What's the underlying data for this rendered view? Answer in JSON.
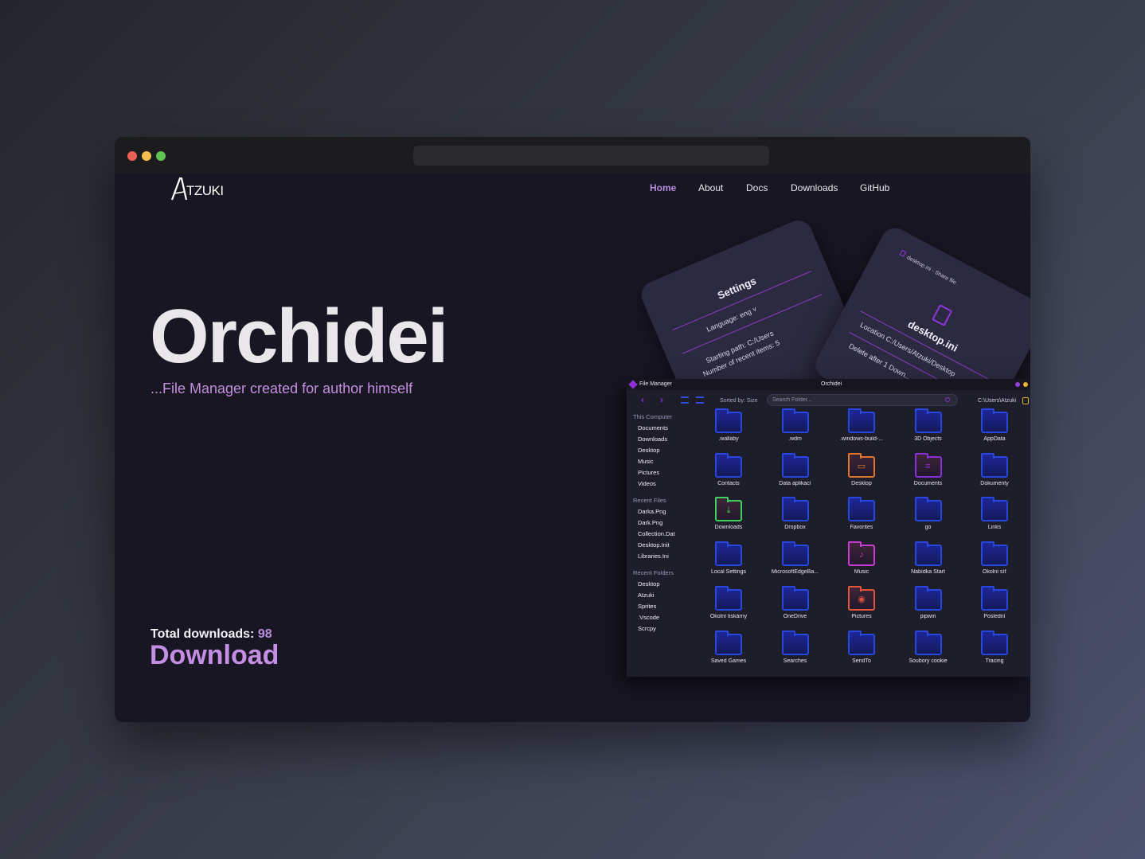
{
  "brand": {
    "logo_text": "TZUKI"
  },
  "nav": {
    "items": [
      {
        "label": "Home",
        "active": true
      },
      {
        "label": "About",
        "active": false
      },
      {
        "label": "Docs",
        "active": false
      },
      {
        "label": "Downloads",
        "active": false
      },
      {
        "label": "GitHub",
        "active": false
      }
    ]
  },
  "hero": {
    "title": "Orchidei",
    "subtitle": "...File Manager created for author himself",
    "downloads_label": "Total downloads:",
    "downloads_count": "98",
    "download_button": "Download"
  },
  "settings_card": {
    "title": "Settings",
    "language": "Language: eng ˅",
    "starting_path": "Starting path: C:/Users",
    "recent_items": "Number of recent items: 5"
  },
  "share_card": {
    "header": "desktop.ini - Share file",
    "filename": "desktop.ini",
    "location": "Location C:/Users/Atzuki/Desktop",
    "delete_after": "Delete after  1 Down..."
  },
  "file_manager": {
    "app_title": "File Manager",
    "window_title": "Orchidei",
    "sorted_by": "Sorted by: Size",
    "search_placeholder": "Search Folder...",
    "path": "C:\\Users\\Atzuki",
    "colors": {
      "accent": "#8f2fd6",
      "folder": "#2846e0",
      "close_dot": "#9b3ce0",
      "min_dot": "#e6b735"
    },
    "sidebar": {
      "this_computer_label": "This Computer",
      "this_computer": [
        "Documents",
        "Downloads",
        "Desktop",
        "Music",
        "Pictures",
        "Videos"
      ],
      "recent_files_label": "Recent Files",
      "recent_files": [
        "Darka.Png",
        "Dark.Png",
        "Collection.Dat",
        "Desktop.Init",
        "Libraries.Ini"
      ],
      "recent_folders_label": "Recent Folders",
      "recent_folders": [
        "Desktop",
        "Atzuki",
        "Sprites",
        ".Vscode",
        "Scrcpy"
      ]
    },
    "folders": [
      {
        "name": ".wallaby",
        "icon": "folder-icon"
      },
      {
        "name": ".wdm",
        "icon": "folder-icon"
      },
      {
        "name": ".windows-build-...",
        "icon": "folder-icon"
      },
      {
        "name": "3D Objects",
        "icon": "folder-icon"
      },
      {
        "name": "AppData",
        "icon": "folder-icon"
      },
      {
        "name": "Contacts",
        "icon": "folder-icon"
      },
      {
        "name": "Data aplikací",
        "icon": "folder-icon"
      },
      {
        "name": "Desktop",
        "icon": "desktop-folder-icon",
        "color": "#e0772f"
      },
      {
        "name": "Documents",
        "icon": "documents-folder-icon",
        "color": "#8a2fd8"
      },
      {
        "name": "Dokumenty",
        "icon": "folder-icon"
      },
      {
        "name": "Downloads",
        "icon": "downloads-folder-icon",
        "color": "#3fcf5f"
      },
      {
        "name": "Dropbox",
        "icon": "folder-icon"
      },
      {
        "name": "Favorites",
        "icon": "folder-icon"
      },
      {
        "name": "go",
        "icon": "folder-icon"
      },
      {
        "name": "Links",
        "icon": "folder-icon"
      },
      {
        "name": "Local Settings",
        "icon": "folder-icon"
      },
      {
        "name": "MicrosoftEdgeBa...",
        "icon": "folder-icon"
      },
      {
        "name": "Music",
        "icon": "music-folder-icon",
        "color": "#c93ad0"
      },
      {
        "name": "Nabídka Start",
        "icon": "folder-icon"
      },
      {
        "name": "Okolní síť",
        "icon": "folder-icon"
      },
      {
        "name": "Okolní tiskárny",
        "icon": "folder-icon"
      },
      {
        "name": "OneDrive",
        "icon": "folder-icon"
      },
      {
        "name": "Pictures",
        "icon": "pictures-folder-icon",
        "color": "#e0553a"
      },
      {
        "name": "pipwin",
        "icon": "folder-icon"
      },
      {
        "name": "Poslední",
        "icon": "folder-icon"
      },
      {
        "name": "Saved Games",
        "icon": "folder-icon"
      },
      {
        "name": "Searches",
        "icon": "folder-icon"
      },
      {
        "name": "SendTo",
        "icon": "folder-icon"
      },
      {
        "name": "Soubory cookie",
        "icon": "folder-icon"
      },
      {
        "name": "Tracing",
        "icon": "folder-icon"
      }
    ]
  }
}
